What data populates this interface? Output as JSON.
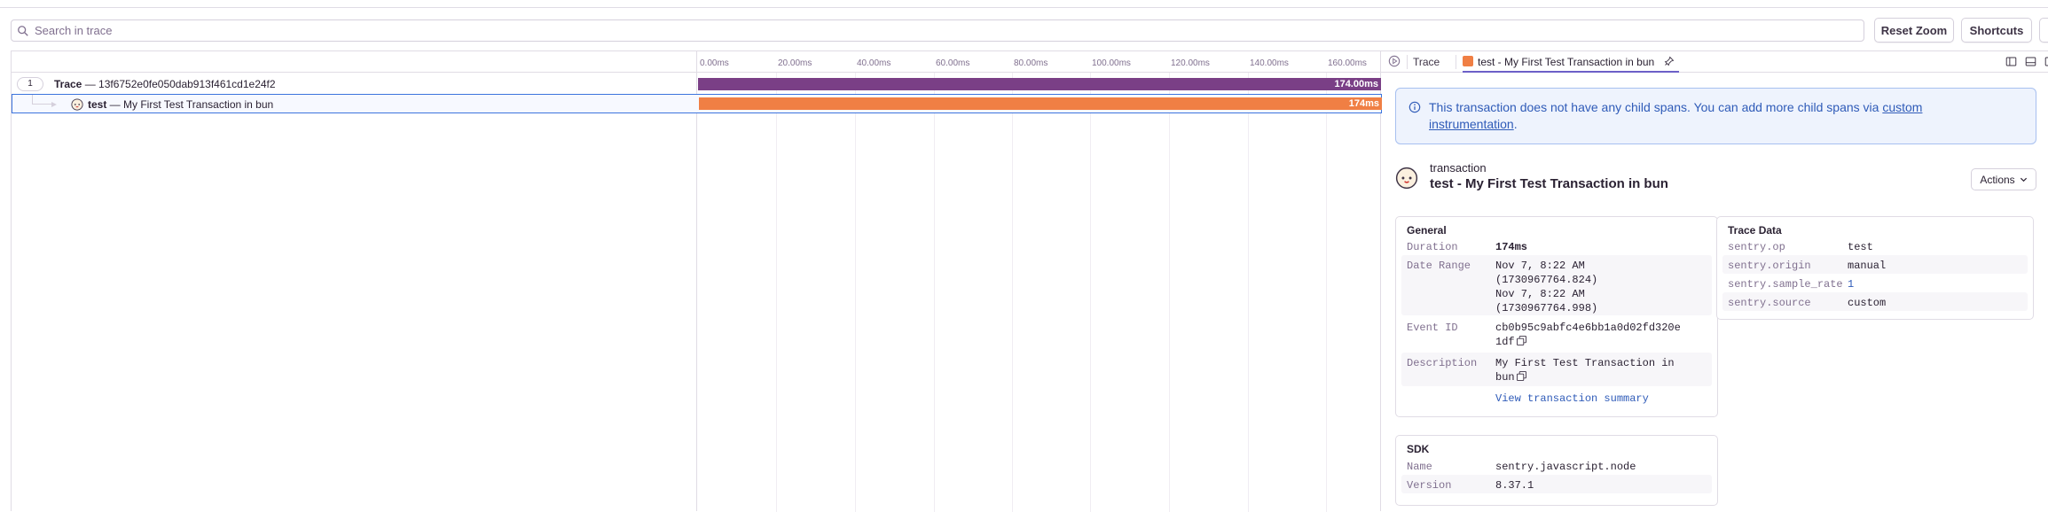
{
  "toolbar": {
    "search_placeholder": "Search in trace",
    "reset_zoom_label": "Reset Zoom",
    "shortcuts_label": "Shortcuts"
  },
  "timeline": {
    "ticks": [
      "0.00ms",
      "20.00ms",
      "40.00ms",
      "60.00ms",
      "80.00ms",
      "100.00ms",
      "120.00ms",
      "140.00ms",
      "160.00ms"
    ]
  },
  "rows": [
    {
      "count": "1",
      "name": "Trace",
      "sep": " — ",
      "detail": "13f6752e0fe050dab913f461cd1e24f2",
      "bar_label": "174.00ms",
      "bar_color": "#7a3f86",
      "start_fraction": 0,
      "duration_fraction": 1
    },
    {
      "name": "test",
      "sep": " — ",
      "detail": "My First Test Transaction in bun",
      "bar_label": "174ms",
      "bar_color": "#f07f44",
      "start_fraction": 0,
      "duration_fraction": 1
    }
  ],
  "tabs": {
    "trace_label": "Trace",
    "active_label": "test - My First Test Transaction in bun",
    "active_color": "#f07f44"
  },
  "alert": {
    "text": "This transaction does not have any child spans. You can add more child spans via ",
    "link": "custom instrumentation",
    "suffix": "."
  },
  "transaction": {
    "kind": "transaction",
    "title": "test - My First Test Transaction in bun",
    "actions_label": "Actions"
  },
  "general": {
    "title": "General",
    "duration_key": "Duration",
    "duration_value": "174ms",
    "date_range_key": "Date Range",
    "date_range_lines": [
      "Nov 7, 8:22 AM",
      "(1730967764.824)",
      "Nov 7, 8:22 AM",
      "(1730967764.998)"
    ],
    "event_id_key": "Event ID",
    "event_id_lines": [
      "cb0b95c9abfc4e6bb1a0d02fd320e",
      "1df"
    ],
    "description_key": "Description",
    "description_lines": [
      "My First Test Transaction in",
      "bun"
    ],
    "view_summary_link": "View transaction summary"
  },
  "trace_data": {
    "title": "Trace Data",
    "items": [
      {
        "key": "sentry.op",
        "value": "test"
      },
      {
        "key": "sentry.origin",
        "value": "manual"
      },
      {
        "key": "sentry.sample_rate",
        "value": "1"
      },
      {
        "key": "sentry.source",
        "value": "custom"
      }
    ]
  },
  "sdk": {
    "title": "SDK",
    "name_key": "Name",
    "name_value": "sentry.javascript.node",
    "version_key": "Version",
    "version_value": "8.37.1"
  },
  "colors": {
    "accent": "#6c5fc7",
    "link": "#2f5bb8",
    "trace_bar": "#7a3f86",
    "span_bar": "#f07f44"
  }
}
